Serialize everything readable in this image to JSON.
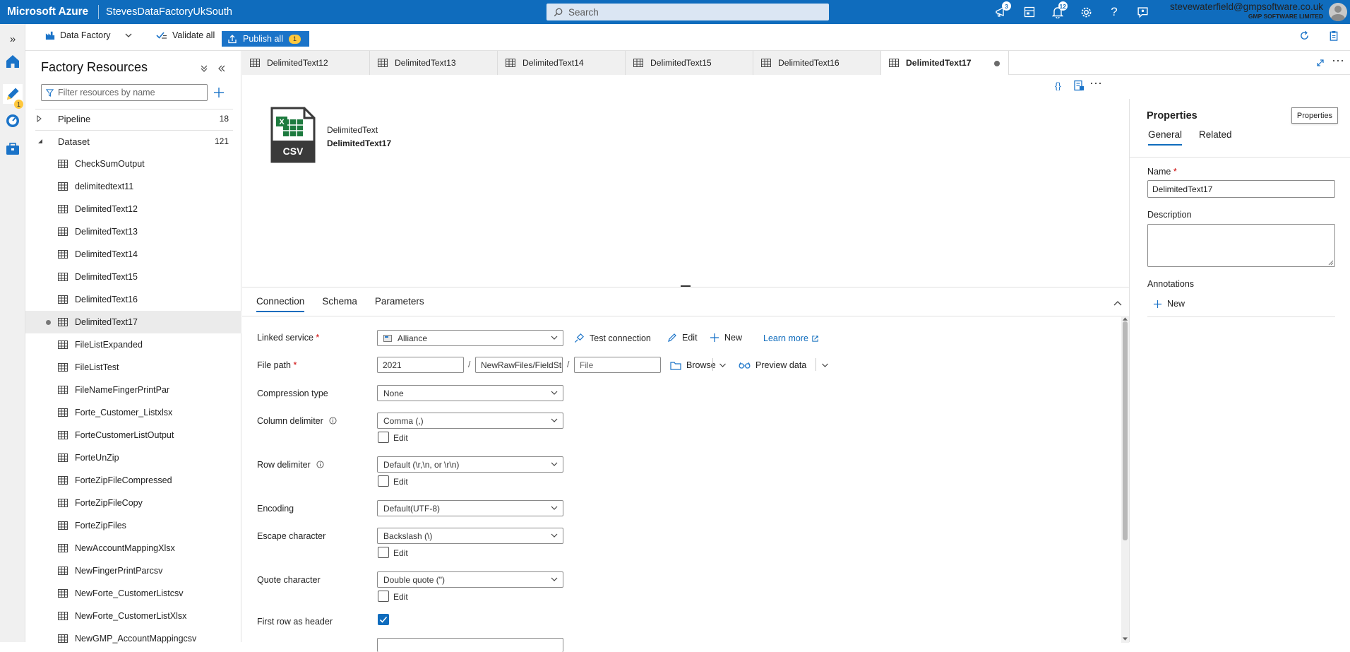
{
  "topbar": {
    "brand": "Microsoft Azure",
    "factory_name": "StevesDataFactoryUkSouth",
    "search_placeholder": "Search",
    "cloudshell_badge": "3",
    "notifications_badge": "12",
    "user_email": "stevewaterfield@gmpsoftware.co.uk",
    "user_org": "GMP SOFTWARE LIMITED"
  },
  "rail": {
    "author_badge": "1"
  },
  "toolbar": {
    "data_factory_label": "Data Factory",
    "validate_all_label": "Validate all",
    "publish_all_label": "Publish all",
    "publish_badge": "1"
  },
  "resources": {
    "title": "Factory Resources",
    "filter_placeholder": "Filter resources by name",
    "pipeline": {
      "label": "Pipeline",
      "count": "18"
    },
    "dataset": {
      "label": "Dataset",
      "count": "121"
    },
    "datasets": [
      "CheckSumOutput",
      "delimitedtext11",
      "DelimitedText12",
      "DelimitedText13",
      "DelimitedText14",
      "DelimitedText15",
      "DelimitedText16",
      "DelimitedText17",
      "FileListExpanded",
      "FileListTest",
      "FileNameFingerPrintPar",
      "Forte_Customer_Listxlsx",
      "ForteCustomerListOutput",
      "ForteUnZip",
      "ForteZipFileCompressed",
      "ForteZipFileCopy",
      "ForteZipFiles",
      "NewAccountMappingXlsx",
      "NewFingerPrintParcsv",
      "NewForte_CustomerListcsv",
      "NewForte_CustomerListXlsx",
      "NewGMP_AccountMappingcsv"
    ],
    "selected_index": 7
  },
  "tabs": [
    "DelimitedText12",
    "DelimitedText13",
    "DelimitedText14",
    "DelimitedText15",
    "DelimitedText16",
    "DelimitedText17"
  ],
  "active_tab_index": 5,
  "canvas": {
    "csv_icon_text": "CSV",
    "node_type": "DelimitedText",
    "node_name": "DelimitedText17"
  },
  "bottom": {
    "tabs": [
      "Connection",
      "Schema",
      "Parameters"
    ],
    "linked_service_label": "Linked service",
    "linked_service_value": "Alliance",
    "test_connection": "Test connection",
    "edit": "Edit",
    "new": "New",
    "learn_more": "Learn more",
    "file_path_label": "File path",
    "file_path_container": "2021",
    "file_path_directory": "NewRawFiles/FieldStrik",
    "file_path_file_placeholder": "File",
    "path_sep": "/",
    "browse": "Browse",
    "preview_data": "Preview data",
    "compression_type_label": "Compression type",
    "compression_type_value": "None",
    "column_delimiter_label": "Column delimiter",
    "column_delimiter_value": "Comma (,)",
    "row_delimiter_label": "Row delimiter",
    "row_delimiter_value": "Default (\\r,\\n, or \\r\\n)",
    "encoding_label": "Encoding",
    "encoding_value": "Default(UTF-8)",
    "escape_character_label": "Escape character",
    "escape_character_value": "Backslash (\\)",
    "quote_character_label": "Quote character",
    "quote_character_value": "Double quote (\")",
    "first_row_header_label": "First row as header",
    "first_row_header_checked": true,
    "edit_checkbox_label": "Edit"
  },
  "properties": {
    "title": "Properties",
    "tabs": [
      "General",
      "Related"
    ],
    "name_label": "Name",
    "name_value": "DelimitedText17",
    "description_label": "Description",
    "annotations_label": "Annotations",
    "new_annotation": "New",
    "tooltip": "Properties"
  },
  "colors": {
    "azure_blue": "#0f6cbd",
    "excel_green": "#1d7a3e",
    "badge_yellow": "#ffc83d"
  }
}
